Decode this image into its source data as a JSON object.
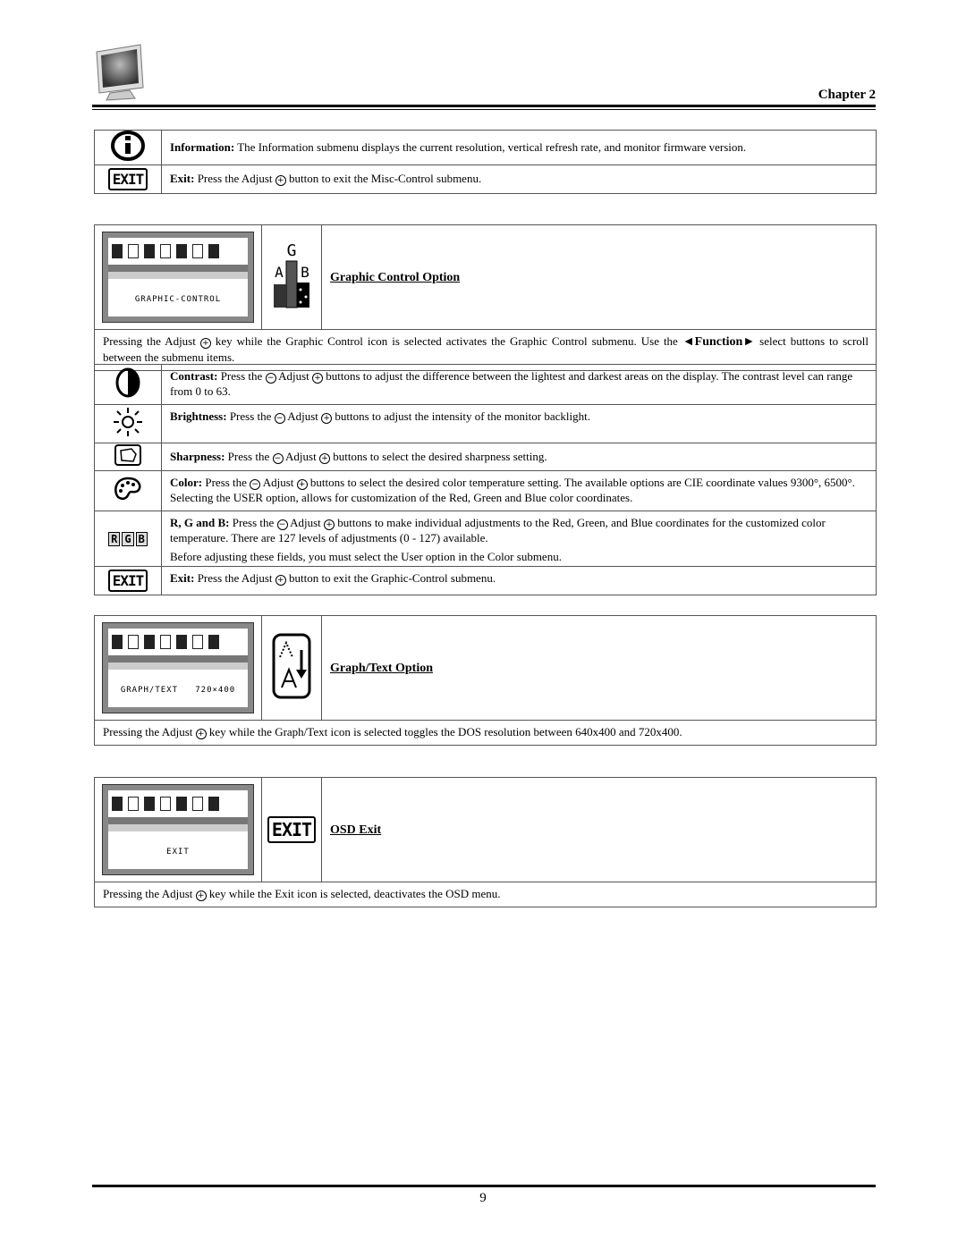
{
  "header": {
    "chapter": "Chapter 2"
  },
  "misc_table": {
    "rows": [
      {
        "icon": "info-icon",
        "label": "Information:",
        "text": " The Information submenu displays the current resolution, vertical refresh rate, and monitor firmware version."
      },
      {
        "icon": "exit-icon",
        "label": "Exit:",
        "text_before": " Press the Adjust ",
        "text_after": " button to exit the Misc-Control submenu."
      }
    ]
  },
  "graphic_control": {
    "osd_label": "GRAPHIC-CONTROL",
    "title": "Graphic Control Option",
    "intro_before": "Pressing the Adjust ",
    "intro_middle": " key while the Graphic Control icon is selected activates the Graphic Control submenu.  Use the ",
    "intro_function": "◄Function►",
    "intro_after": " select buttons to scroll between the submenu items.",
    "rows": [
      {
        "icon": "contrast-icon",
        "label": "Contrast:",
        "t1": " Press the ",
        "t2": " Adjust ",
        "t3": " buttons to adjust the difference between the lightest and darkest areas on the display.  The contrast level can range from 0 to 63."
      },
      {
        "icon": "brightness-icon",
        "label": "Brightness:",
        "t1": " Press the ",
        "t2": " Adjust ",
        "t3": " buttons to adjust the intensity of the monitor backlight."
      },
      {
        "icon": "sharpness-icon",
        "label": "Sharpness:",
        "t1": " Press the ",
        "t2": " Adjust ",
        "t3": " buttons to select the desired sharpness setting."
      },
      {
        "icon": "color-palette-icon",
        "label": "Color:",
        "t1": " Press the ",
        "t2": " Adjust ",
        "t3": " buttons to select the desired color temperature setting.  The available options are CIE coordinate values 9300°, 6500°.  Selecting the USER option, allows for customization of the Red, Green and Blue color coordinates."
      },
      {
        "icon": "rgb-icon",
        "label": "R, G and B:",
        "t1": " Press the ",
        "t2": " Adjust ",
        "t3": " buttons to make individual adjustments to the Red, Green, and Blue coordinates for the customized color temperature. There are 127 levels of adjustments (0 - 127) available.",
        "note": "Before adjusting these fields, you must select the User option in the Color submenu."
      },
      {
        "icon": "exit-icon",
        "label": "Exit:",
        "t1": " Press the Adjust ",
        "t3": " button to exit the Graphic-Control submenu."
      }
    ],
    "rgb_letters": [
      "R",
      "G",
      "B"
    ]
  },
  "graph_text": {
    "osd_label": "GRAPH/TEXT   720×400",
    "title": "Graph/Text Option",
    "desc_before": "Pressing the Adjust ",
    "desc_after": " key while the Graph/Text icon is selected toggles the DOS resolution between 640x400 and 720x400."
  },
  "osd_exit": {
    "osd_label": "EXIT",
    "title": "OSD Exit",
    "desc_before": "Pressing the Adjust ",
    "desc_after": " key while the Exit icon is selected, deactivates the OSD menu."
  },
  "glyphs": {
    "plus": "+",
    "minus": "−",
    "exit": "EXIT",
    "g_letter": "G",
    "ab": "A▦B"
  },
  "footer": {
    "page_number": "9"
  }
}
